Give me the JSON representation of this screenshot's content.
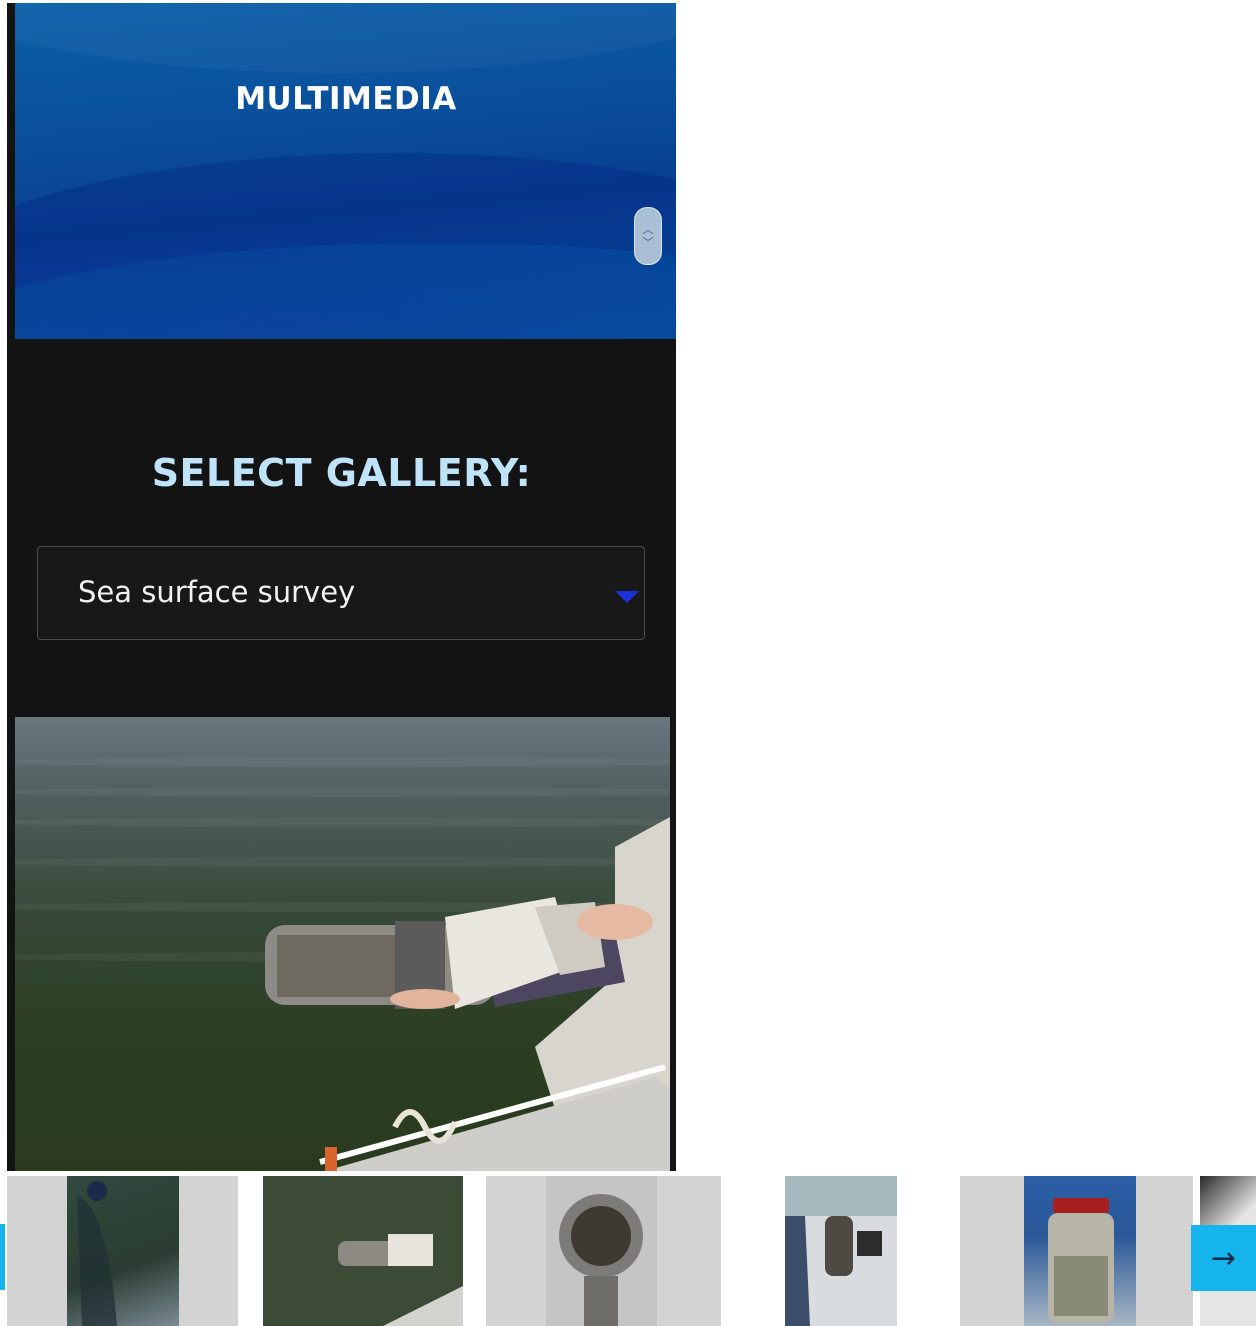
{
  "hero": {
    "title": "MULTIMEDIA"
  },
  "gallery": {
    "heading": "SELECT GALLERY:",
    "selected": "Sea surface survey"
  },
  "main_image": {
    "alt": "Sea surface sampling net held over water from boat"
  },
  "thumbnails": [
    {
      "name": "thumb-buoy-line"
    },
    {
      "name": "thumb-net-tube"
    },
    {
      "name": "thumb-net-mouth"
    },
    {
      "name": "thumb-boat-deck"
    },
    {
      "name": "thumb-sample-jar"
    }
  ],
  "nav": {
    "next_icon": "arrow-right-icon",
    "prev_icon": "arrow-left-icon"
  }
}
